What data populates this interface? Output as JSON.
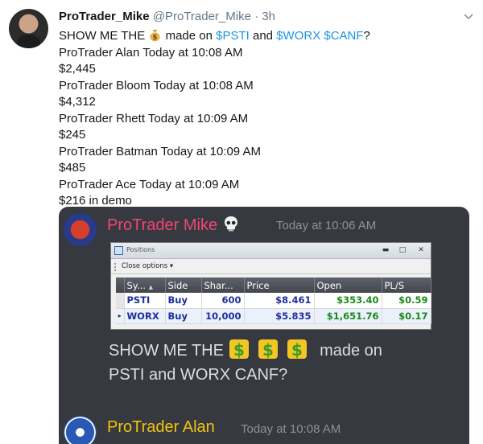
{
  "tweet": {
    "display_name": "ProTrader_Mike",
    "handle": "@ProTrader_Mike",
    "separator": "·",
    "time": "3h",
    "text_prefix": "SHOW ME THE ",
    "text_mid": " made on ",
    "cashtag_1": "$PSTI",
    "text_and": " and ",
    "cashtag_2": "$WORX $CANF",
    "text_suffix": "?",
    "lines": [
      "ProTrader Alan Today at 10:08 AM",
      "$2,445",
      "ProTrader Bloom Today at 10:08 AM",
      "$4,312",
      "ProTrader Rhett Today at 10:09 AM",
      "$245",
      "ProTrader Batman Today at 10:09 AM",
      "$485",
      "ProTrader Ace Today at 10:09 AM",
      "$216 in demo"
    ]
  },
  "discord": {
    "message_1": {
      "author": "ProTrader Mike",
      "timestamp": "Today at 10:06 AM",
      "text_line_1": "SHOW ME THE",
      "text_line_1_tail": "made on",
      "text_line_2": "PSTI and WORX CANF?"
    },
    "message_2": {
      "author": "ProTrader Alan",
      "timestamp": "Today at 10:08 AM"
    },
    "positions_window": {
      "title": "Positions",
      "toolbar_button": "Close options ▾",
      "columns": [
        "Sy...",
        "Side",
        "Shar...",
        "Price",
        "Open",
        "PL/S"
      ],
      "sort_indicator": "▲",
      "rows": [
        {
          "symbol": "PSTI",
          "side": "Buy",
          "shares": "600",
          "price": "$8.461",
          "open": "$353.40",
          "pls": "$0.59"
        },
        {
          "symbol": "WORX",
          "side": "Buy",
          "shares": "10,000",
          "price": "$5.835",
          "open": "$1,651.76",
          "pls": "$0.17"
        }
      ]
    }
  },
  "colors": {
    "cashtag": "#1b95e0",
    "discord_bg": "#36393f",
    "author_1": "#f04573",
    "author_2": "#f1c40f",
    "gain": "#1a8a1a"
  }
}
